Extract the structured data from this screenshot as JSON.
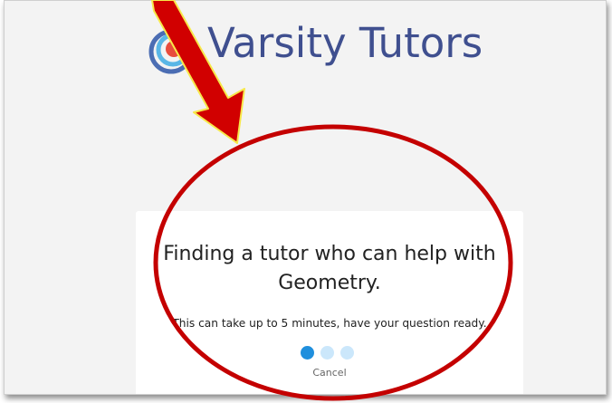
{
  "brand": {
    "name": "Varsity Tutors",
    "logo_icon": "varsity-tutors-logo-icon",
    "text_color": "#3f4f8f"
  },
  "card": {
    "title": "Finding a tutor who can help with Geometry.",
    "subtitle": "This can take up to 5 minutes, have your question ready.",
    "cancel_label": "Cancel",
    "loading_dots": {
      "count": 3,
      "active_index": 0,
      "active_color": "#1f8fdd",
      "inactive_color": "#cbe7fb"
    }
  },
  "annotation": {
    "arrow_color": "#d10000",
    "arrow_outline_color": "#f7e84a",
    "circle_color": "#c40000"
  }
}
